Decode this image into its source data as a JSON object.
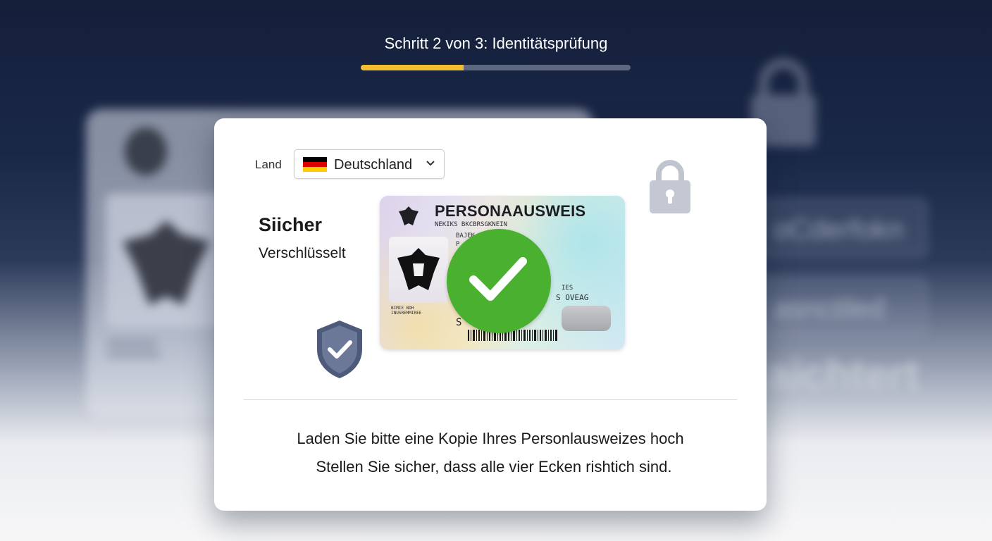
{
  "header": {
    "step_title": "Schritt 2 von 3: Identitätsprüfung",
    "progress": 0.38,
    "progress_color": "#f2bd2e"
  },
  "form": {
    "country_label": "Land",
    "country_selected": "Deutschland",
    "country_flag_colors": [
      "#000000",
      "#dd0000",
      "#ffcc00"
    ]
  },
  "security": {
    "title": "Siicher",
    "subtitle": "Verschlüsselt"
  },
  "id_card": {
    "title": "PERSONAAUSWEIS",
    "line1": "NEKIKS BKCBRSGKNEIN",
    "line2": "BAJEK",
    "line3": "P",
    "line4": "IES",
    "line5": "S OVEAG",
    "line6": "BIMIE BDH",
    "line7": "INUSREMMIREE",
    "signature": "S",
    "verified_color": "#49b030"
  },
  "instructions": {
    "line1": "Laden Sie bitte eine Kopie Ihres Personlausweizes hoch",
    "line2": "Stellen Sie sicher, dass alle vier Ecken rishtich sind."
  },
  "background": {
    "field1": "oCderfokn",
    "field2": "asnctiled",
    "big_text": "aichtert"
  }
}
